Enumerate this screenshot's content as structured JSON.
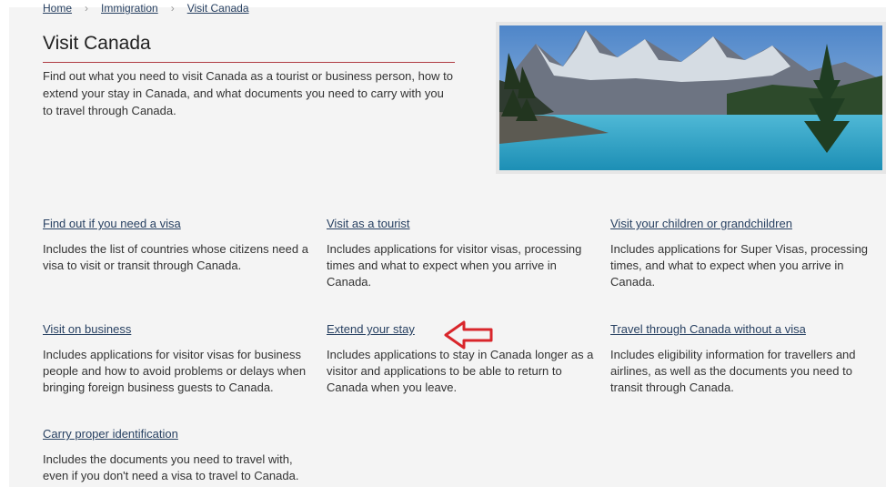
{
  "breadcrumb": [
    "Home",
    "Immigration",
    "Visit Canada"
  ],
  "page": {
    "title": "Visit Canada",
    "intro": "Find out what you need to visit Canada as a tourist or business person, how to extend your stay in Canada, and what documents you need to carry with you to travel through Canada."
  },
  "cards": [
    {
      "label": "Find out if you need a visa",
      "desc": "Includes the list of countries whose citizens need a visa to visit or transit through Canada."
    },
    {
      "label": "Visit as a tourist",
      "desc": "Includes applications for visitor visas, processing times and what to expect when you arrive in Canada."
    },
    {
      "label": "Visit your children or grandchildren",
      "desc": "Includes applications for Super Visas, processing times, and what to expect when you arrive in Canada."
    },
    {
      "label": "Visit on business",
      "desc": "Includes applications for visitor visas for business people and how to avoid problems or delays when bringing foreign business guests to Canada."
    },
    {
      "label": "Extend your stay",
      "desc": "Includes applications to stay in Canada longer as a visitor and applications to be able to return to Canada when you leave."
    },
    {
      "label": "Travel through Canada without a visa",
      "desc": "Includes eligibility information for travellers and airlines, as well as the documents you need to transit through Canada."
    },
    {
      "label": "Carry proper identification",
      "desc": "Includes the documents you need to travel with, even if you don't need a visa to travel to Canada."
    }
  ],
  "annotation": {
    "icon": "red-outline-arrow-left-icon",
    "color": "#d9262b"
  },
  "colors": {
    "link": "#284162",
    "title_rule": "#af3c43",
    "background": "#f4f4f4"
  },
  "hero_image": {
    "icon": "mountain-lake-photo"
  }
}
